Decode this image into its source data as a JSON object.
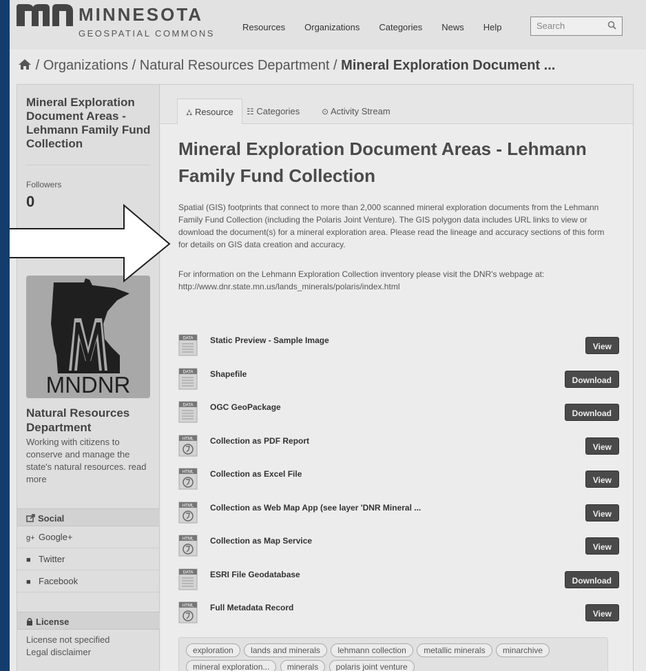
{
  "header": {
    "logo_title": "MINNESOTA",
    "logo_subtitle": "GEOSPATIAL COMMONS",
    "nav": [
      "Resources",
      "Organizations",
      "Categories",
      "News",
      "Help"
    ],
    "search_placeholder": "Search"
  },
  "breadcrumb": {
    "sep1": "/",
    "item1": "Organizations",
    "sep2": "/",
    "item2": "Natural Resources Department",
    "sep3": "/",
    "current": "Mineral Exploration Document ..."
  },
  "sidebar": {
    "title": "Mineral Exploration Document Areas - Lehmann Family Fund Collection",
    "followers_label": "Followers",
    "followers_count": "0",
    "org_logo_text": "MNDNR",
    "org_name": "Natural Resources Department",
    "org_description": "Working with citizens to conserve and manage the state's natural resources. read more",
    "social_header": "Social",
    "social": [
      "Google+",
      "Twitter",
      "Facebook"
    ],
    "license_header": "License",
    "license_text": "License not specified",
    "legal_disclaimer": "Legal disclaimer"
  },
  "tabs": [
    "Resource",
    "Categories",
    "Activity Stream"
  ],
  "dataset": {
    "title": "Mineral Exploration Document Areas - Lehmann Family Fund Collection",
    "description": "Spatial (GIS) footprints that connect to more than 2,000 scanned mineral exploration documents from the Lehmann Family Fund Collection (including the Polaris Joint Venture). The GIS polygon data includes URL links to view or download the document(s) for a mineral exploration area. Please read the lineage and accuracy sections of this form for details on GIS data creation and accuracy.",
    "description2": "For information on the Lehmann Exploration Collection inventory please visit the DNR's webpage at: http://www.dnr.state.mn.us/lands_minerals/polaris/index.html"
  },
  "resources": [
    {
      "title": "Static Preview - Sample Image",
      "icon": "DATA",
      "button": "View"
    },
    {
      "title": "Shapefile",
      "icon": "DATA",
      "button": "Download"
    },
    {
      "title": "OGC GeoPackage",
      "icon": "DATA",
      "button": "Download"
    },
    {
      "title": "Collection as PDF Report",
      "icon": "HTML",
      "button": "View"
    },
    {
      "title": "Collection as Excel File",
      "icon": "HTML",
      "button": "View"
    },
    {
      "title": "Collection as Web Map App (see layer 'DNR Mineral ...",
      "icon": "HTML",
      "button": "View"
    },
    {
      "title": "Collection as Map Service",
      "icon": "HTML",
      "button": "View"
    },
    {
      "title": "ESRI File Geodatabase",
      "icon": "DATA",
      "button": "Download"
    },
    {
      "title": "Full Metadata Record",
      "icon": "HTML",
      "button": "View"
    }
  ],
  "tags": [
    "exploration",
    "lands and minerals",
    "lehmann collection",
    "metallic minerals",
    "minarchive",
    "mineral exploration...",
    "minerals",
    "polaris joint venture"
  ],
  "colors": {
    "frame": "#143c6d",
    "button": "#4a4a4a",
    "page": "#e9e9e9"
  }
}
